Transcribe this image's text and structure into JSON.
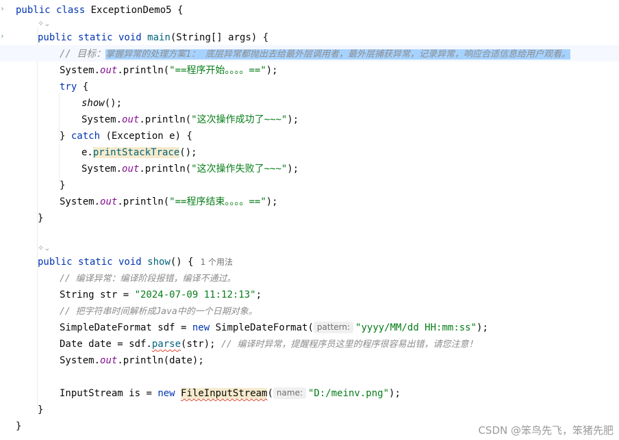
{
  "editor": {
    "lines": {
      "l1": {
        "kw": "public class",
        "name": " ExceptionDemo5 {"
      },
      "l3": {
        "kw": "public static void",
        "fn": "main",
        "rest": "(String[] args) {"
      },
      "l4": {
        "comment_prefix": "// 目标：",
        "comment_sel": "掌握异常的处理方案1： 底层异常都抛出去给最外层调用者，最外层捕获异常，记录异常，响应合适信息给用户观看。"
      },
      "l5": {
        "pre": "System.",
        "field": "out",
        "mid": ".println(",
        "str": "\"==程序开始。。。。==\"",
        "end": ");"
      },
      "l6": {
        "kw": "try",
        "rest": " {"
      },
      "l7": {
        "call": "show",
        "end": "();"
      },
      "l8": {
        "pre": "System.",
        "field": "out",
        "mid": ".println(",
        "str": "\"这次操作成功了~~~\"",
        "end": ");"
      },
      "l9": {
        "pre": "} ",
        "kw": "catch",
        "rest": " (Exception e) {"
      },
      "l10": {
        "pre": "e.",
        "warn": "printStackTrace",
        "end": "();"
      },
      "l11": {
        "pre": "System.",
        "field": "out",
        "mid": ".println(",
        "str": "\"这次操作失败了~~~\"",
        "end": ");"
      },
      "l12": {
        "text": "}"
      },
      "l13": {
        "pre": "System.",
        "field": "out",
        "mid": ".println(",
        "str": "\"==程序结束。。。。==\"",
        "end": ");"
      },
      "l14": {
        "text": "}"
      },
      "l16": {
        "kw": "public static void",
        "fn": "show",
        "rest": "() {",
        "usage": "1 个用法"
      },
      "l17": {
        "comment": "// 编译异常：编译阶段报错，编译不通过。"
      },
      "l18": {
        "pre": "String str = ",
        "str": "\"2024-07-09 11:12:13\"",
        "end": ";"
      },
      "l19": {
        "comment": "// 把字符串时间解析成Java中的一个日期对象。"
      },
      "l20": {
        "pre": "SimpleDateFormat sdf = ",
        "kw": "new",
        "mid": " SimpleDateFormat(",
        "hint": "pattern:",
        "str": "\"yyyy/MM/dd HH:mm:ss\"",
        "end": ");"
      },
      "l21": {
        "pre": "Date date = sdf.",
        "warn": "parse",
        "mid": "(str); ",
        "comment": "// 编译时异常，提醒程序员这里的程序很容易出错，请您注意！"
      },
      "l22": {
        "pre": "System.",
        "field": "out",
        "mid": ".println(date);"
      },
      "l24": {
        "pre": "InputStream ",
        "is": "is",
        "mid": " = ",
        "kw": "new",
        "warn": "FileInputStream",
        "open": "(",
        "hint": "name:",
        "str": "\"D:/meinv.png\"",
        "end": ");"
      },
      "l25": {
        "text": "}"
      },
      "l26": {
        "text": "}"
      }
    },
    "icons": [
      "run-gutter-icon",
      "ai-assist-icon"
    ],
    "colors": {
      "keyword": "#0033b3",
      "method": "#00627a",
      "field": "#871094",
      "string": "#067d17",
      "comment": "#8c8c8c",
      "selection": "#a6d2ff"
    }
  },
  "watermark": "CSDN @笨鸟先飞，笨猪先肥"
}
